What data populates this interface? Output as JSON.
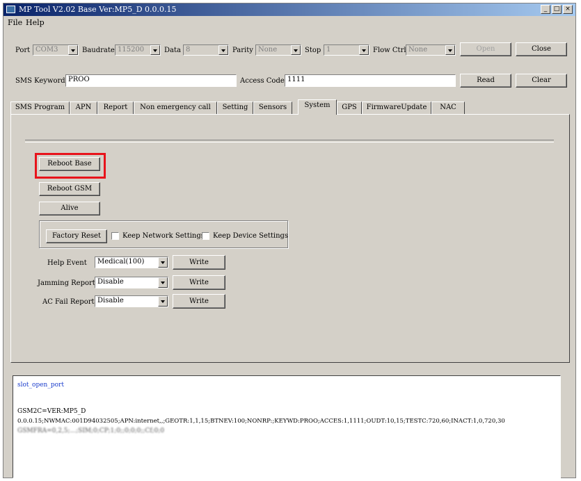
{
  "window": {
    "title": "MP Tool V2.02  Base Ver:MP5_D 0.0.0.15"
  },
  "menu": [
    "File",
    "Help"
  ],
  "connection": {
    "port_label": "Port",
    "port_value": "COM3",
    "baudrate_label": "Baudrate",
    "baudrate_value": "115200",
    "data_label": "Data",
    "data_value": "8",
    "parity_label": "Parity",
    "parity_value": "None",
    "stop_label": "Stop",
    "stop_value": "1",
    "flowctrl_label": "Flow Ctrl",
    "flowctrl_value": "None",
    "open_label": "Open",
    "close_label": "Close"
  },
  "sms": {
    "keyword_label": "SMS Keyword",
    "keyword_value": "PROO",
    "access_label": "Access Code",
    "access_value": "1111",
    "read_label": "Read",
    "clear_label": "Clear"
  },
  "tabs": [
    "SMS Program",
    "APN",
    "Report",
    "Non emergency call",
    "Setting",
    "Sensors",
    "System",
    "GPS",
    "FirmwareUpdate",
    "NAC"
  ],
  "active_tab": "System",
  "system": {
    "reboot_base": "Reboot Base",
    "reboot_gsm": "Reboot GSM",
    "alive": "Alive",
    "factory_reset": "Factory Reset",
    "keep_network": "Keep Network Settings",
    "keep_device": "Keep Device Settings",
    "rows": [
      {
        "label": "Help Event",
        "value": "Medical(100)",
        "button": "Write"
      },
      {
        "label": "Jamming Report",
        "value": "Disable",
        "button": "Write"
      },
      {
        "label": "AC Fail Report",
        "value": "Disable",
        "button": "Write"
      }
    ]
  },
  "log": {
    "line1": "slot_open_port",
    "line2": "GSM2C=VER:MP5_D",
    "line3": "0.0.0.15;NWMAC:001D94032505;APN:internet,,;GEOTR:1,1,15;BTNEV:100;NONRP:;KEYWD:PROO;ACCES:1,1111;OUDT:10,15;TESTC:720,60;INACT:1,0,720,30",
    "line4": "GSMFRA=0,2,5;...;SIM;0;CP;1;0;;0;0;0;;Cf;0;0"
  },
  "colors": {
    "highlight": "#e8131b",
    "log_link": "#1a3ccc"
  }
}
